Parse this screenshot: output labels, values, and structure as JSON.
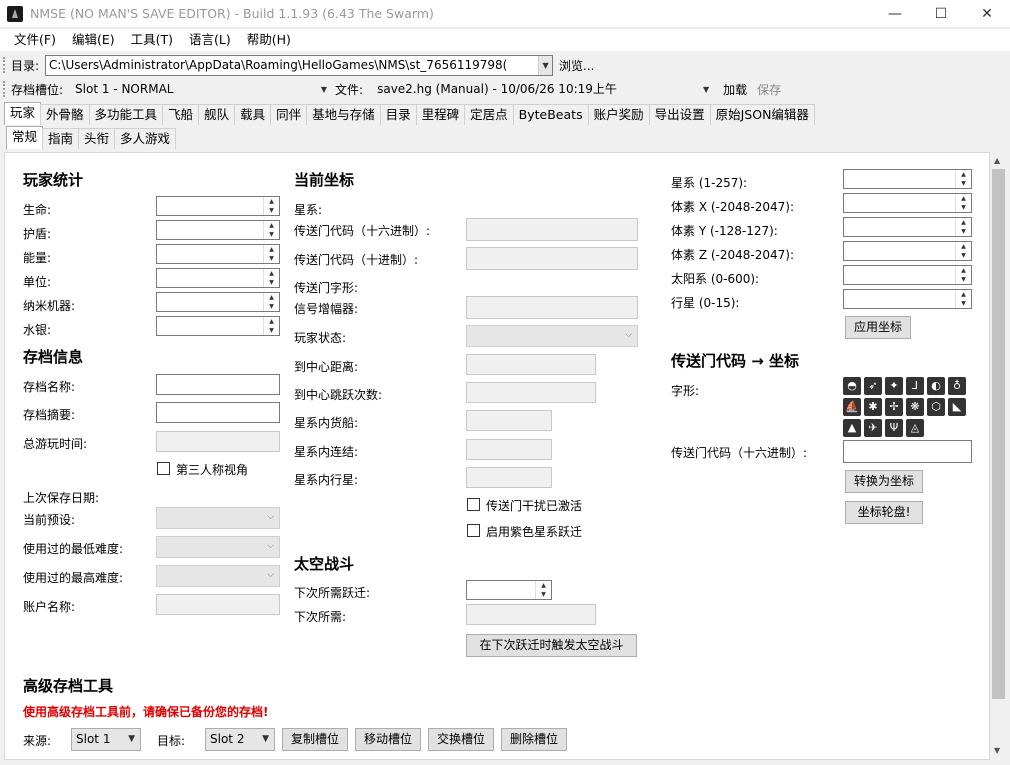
{
  "window": {
    "title": "NMSE (NO MAN'S SAVE EDITOR) - Build 1.1.93 (6.43 The Swarm)",
    "minimize": "—",
    "maximize": "☐",
    "close": "✕"
  },
  "menu": [
    "文件(F)",
    "编辑(E)",
    "工具(T)",
    "语言(L)",
    "帮助(H)"
  ],
  "toolbar1": {
    "dir_label": "目录:",
    "dir_value": "C:\\Users\\Administrator\\AppData\\Roaming\\HelloGames\\NMS\\st_7656119798(",
    "browse": "浏览..."
  },
  "toolbar2": {
    "slot_label": "存档槽位:",
    "slot_value": "Slot 1 - NORMAL",
    "file_label": "文件:",
    "file_value": "save2.hg (Manual) - 10/06/26 10:19上午",
    "load": "加载",
    "save": "保存"
  },
  "main_tabs": [
    "玩家",
    "外骨骼",
    "多功能工具",
    "飞船",
    "舰队",
    "载具",
    "同伴",
    "基地与存储",
    "目录",
    "里程碑",
    "定居点",
    "ByteBeats",
    "账户奖励",
    "导出设置",
    "原始JSON编辑器"
  ],
  "sub_tabs": [
    "常规",
    "指南",
    "头衔",
    "多人游戏"
  ],
  "player_stats": {
    "title": "玩家统计",
    "health": "生命:",
    "shield": "护盾:",
    "energy": "能量:",
    "units": "单位:",
    "nanites": "纳米机器:",
    "quicksilver": "水银:"
  },
  "save_info": {
    "title": "存档信息",
    "save_name": "存档名称:",
    "save_summary": "存档摘要:",
    "total_playtime": "总游玩时间:",
    "third_person": "第三人称视角",
    "last_save_date": "上次保存日期:",
    "current_preset": "当前预设:",
    "min_difficulty": "使用过的最低难度:",
    "max_difficulty": "使用过的最高难度:",
    "account_name": "账户名称:"
  },
  "coords": {
    "title": "当前坐标",
    "galaxy": "星系:",
    "portal_hex": "传送门代码（十六进制）:",
    "portal_dec": "传送门代码（十进制）:",
    "portal_glyphs": "传送门字形:",
    "signal_booster": "信号增幅器:",
    "player_state": "玩家状态:",
    "dist_center": "到中心距离:",
    "jumps_center": "到中心跳跃次数:",
    "freighters": "星系内货船:",
    "connections": "星系内连结:",
    "planets": "星系内行星:",
    "portal_interference": "传送门干扰已激活",
    "purple_jump": "启用紫色星系跃迁"
  },
  "space_battle": {
    "title": "太空战斗",
    "next_jumps": "下次所需跃迁:",
    "next_required": "下次所需:",
    "trigger": "在下次跃迁时触发太空战斗"
  },
  "coord_inputs": {
    "galaxy": "星系 (1-257):",
    "voxel_x": "体素 X (-2048-2047):",
    "voxel_y": "体素 Y (-128-127):",
    "voxel_z": "体素 Z (-2048-2047):",
    "solar": "太阳系 (0-600):",
    "planet": "行星 (0-15):",
    "apply": "应用坐标"
  },
  "portal_convert": {
    "title": "传送门代码 → 坐标",
    "glyphs_label": "字形:",
    "hex_label": "传送门代码（十六进制）:",
    "convert": "转换为坐标",
    "roulette": "坐标轮盘!",
    "glyph_icons": [
      "sunset-glyph-icon",
      "bird-glyph-icon",
      "face-glyph-icon",
      "diplo-glyph-icon",
      "eclipse-glyph-icon",
      "balloon-glyph-icon",
      "boat-glyph-icon",
      "bug-glyph-icon",
      "dragonfly-glyph-icon",
      "galaxy-glyph-icon",
      "voxel-glyph-icon",
      "fish-glyph-icon",
      "tent-glyph-icon",
      "rocket-glyph-icon",
      "tree-glyph-icon",
      "atlas-glyph-icon"
    ]
  },
  "advanced": {
    "title": "高级存档工具",
    "warning": "使用高级存档工具前，请确保已备份您的存档!",
    "source_label": "来源:",
    "source_value": "Slot 1",
    "target_label": "目标:",
    "target_value": "Slot 2",
    "copy": "复制槽位",
    "move": "移动槽位",
    "swap": "交换槽位",
    "delete": "删除槽位"
  }
}
